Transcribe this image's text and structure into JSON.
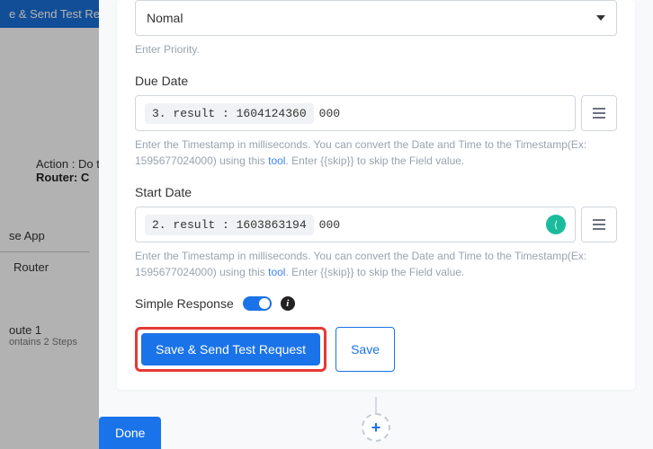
{
  "background": {
    "header_btn_partial": "e & Send Test Req",
    "action_label": "Action : Do t",
    "router_label": "Router: C",
    "app_label": "se App",
    "router_item": "Router",
    "route1_label": "oute 1",
    "route1_sub": "ontains 2 Steps"
  },
  "priority": {
    "value": "Nomal",
    "help": "Enter Priority."
  },
  "due_date": {
    "label": "Due Date",
    "token": "3. result : 1604124360",
    "suffix": "000",
    "help_prefix": "Enter the Timestamp in milliseconds. You can convert the Date and Time to the Timestamp(Ex: 1595677024000) using this ",
    "help_link": "tool",
    "help_suffix": ". Enter {{skip}} to skip the Field value."
  },
  "start_date": {
    "label": "Start Date",
    "token": "2. result : 1603863194",
    "suffix": "000",
    "help_prefix": "Enter the Timestamp in milliseconds. You can convert the Date and Time to the Timestamp(Ex: 1595677024000) using this ",
    "help_link": "tool",
    "help_suffix": ". Enter {{skip}} to skip the Field value."
  },
  "simple_response": {
    "label": "Simple Response"
  },
  "buttons": {
    "save_send": "Save & Send Test Request",
    "save": "Save",
    "done": "Done"
  }
}
